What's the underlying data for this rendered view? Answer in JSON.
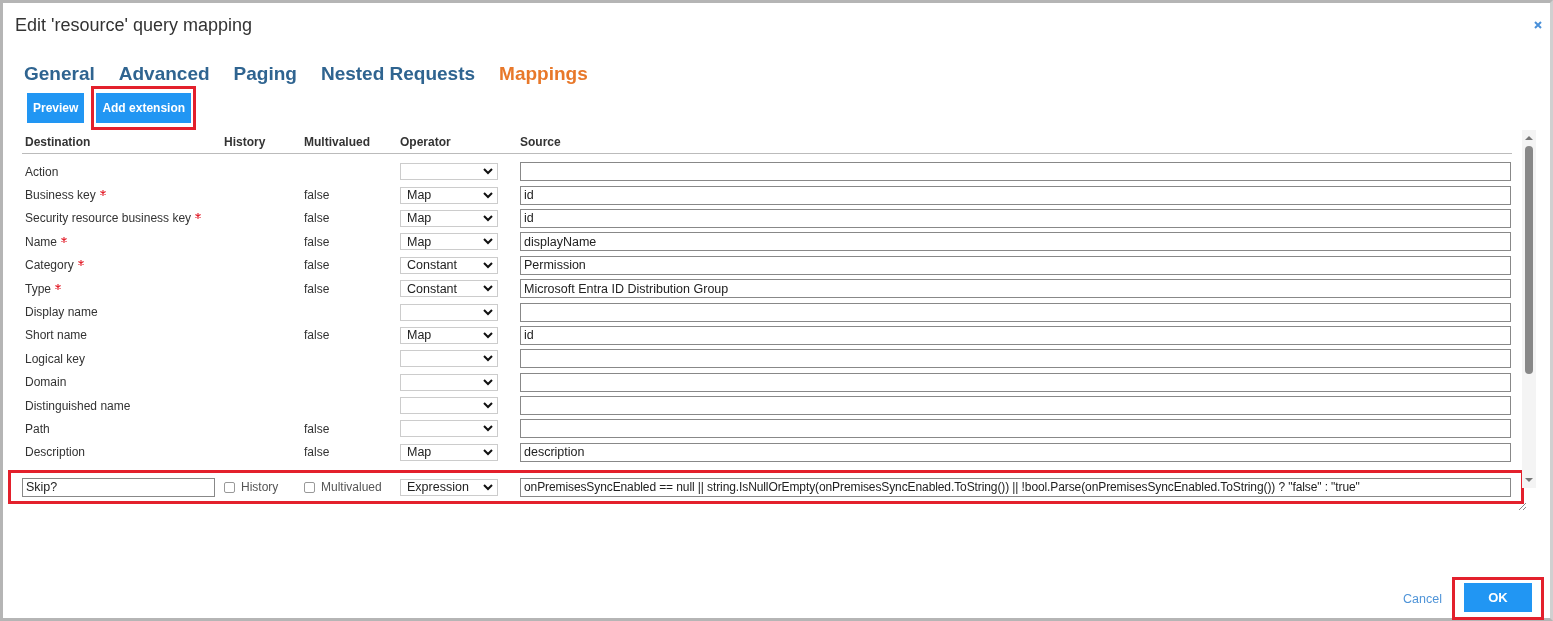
{
  "window": {
    "title": "Edit 'resource' query mapping"
  },
  "tabs": [
    {
      "label": "General",
      "selected": false
    },
    {
      "label": "Advanced",
      "selected": false
    },
    {
      "label": "Paging",
      "selected": false
    },
    {
      "label": "Nested Requests",
      "selected": false
    },
    {
      "label": "Mappings",
      "selected": true
    }
  ],
  "toolbar": [
    {
      "label": "Preview",
      "highlighted": false
    },
    {
      "label": "Add extension",
      "highlighted": true
    }
  ],
  "table": {
    "columns": [
      "Destination",
      "History",
      "Multivalued",
      "Operator",
      "Source"
    ],
    "rows": [
      {
        "destination": "Action",
        "required": false,
        "operator": "",
        "source": ""
      },
      {
        "destination": "Business key",
        "required": true,
        "multivalued": "false",
        "operator": "Map",
        "source": "id"
      },
      {
        "destination": "Security resource business key",
        "required": true,
        "multivalued": "false",
        "operator": "Map",
        "source": "id"
      },
      {
        "destination": "Name",
        "required": true,
        "multivalued": "false",
        "operator": "Map",
        "source": "displayName"
      },
      {
        "destination": "Category",
        "required": true,
        "multivalued": "false",
        "operator": "Constant",
        "source": "Permission"
      },
      {
        "destination": "Type",
        "required": true,
        "multivalued": "false",
        "operator": "Constant",
        "source": "Microsoft Entra ID Distribution Group"
      },
      {
        "destination": "Display name",
        "required": false,
        "operator": "",
        "source": ""
      },
      {
        "destination": "Short name",
        "required": false,
        "multivalued": "false",
        "operator": "Map",
        "source": "id"
      },
      {
        "destination": "Logical key",
        "required": false,
        "operator": "",
        "source": ""
      },
      {
        "destination": "Domain",
        "required": false,
        "operator": "",
        "source": ""
      },
      {
        "destination": "Distinguished name",
        "required": false,
        "operator": "",
        "source": ""
      },
      {
        "destination": "Path",
        "required": false,
        "multivalued": "false",
        "operator": "",
        "source": ""
      },
      {
        "destination": "Description",
        "required": false,
        "multivalued": "false",
        "operator": "Map",
        "source": "description"
      }
    ]
  },
  "extension": {
    "destination": "Skip?",
    "history_label": "History",
    "history_checked": false,
    "multivalued_label": "Multivalued",
    "multivalued_checked": false,
    "operator": "Expression",
    "source": "onPremisesSyncEnabled == null || string.IsNullOrEmpty(onPremisesSyncEnabled.ToString()) || !bool.Parse(onPremisesSyncEnabled.ToString()) ? \"false\" : \"true\"",
    "highlighted": true
  },
  "footer": {
    "cancel": "Cancel",
    "ok": "OK",
    "ok_highlighted": true
  }
}
